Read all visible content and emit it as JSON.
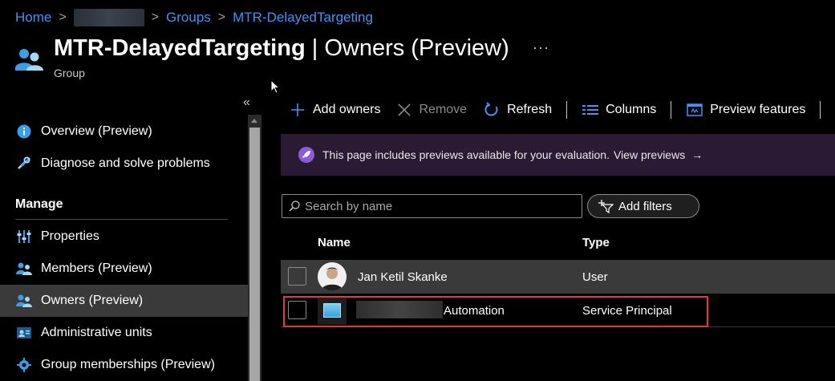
{
  "breadcrumb": {
    "home": "Home",
    "groups": "Groups",
    "current": "MTR-DelayedTargeting",
    "separator": ">"
  },
  "header": {
    "title_strong": "MTR-DelayedTargeting",
    "title_rest": " | Owners (Preview)",
    "subtitle": "Group",
    "more": "···"
  },
  "sidebar": {
    "collapse": "«",
    "manage_heading": "Manage",
    "items": [
      {
        "label": "Overview (Preview)",
        "icon": "info-icon"
      },
      {
        "label": "Diagnose and solve problems",
        "icon": "wrench-icon"
      },
      {
        "label": "Properties",
        "icon": "properties-icon"
      },
      {
        "label": "Members (Preview)",
        "icon": "members-icon"
      },
      {
        "label": "Owners (Preview)",
        "icon": "owners-icon",
        "selected": true
      },
      {
        "label": "Administrative units",
        "icon": "admin-units-icon"
      },
      {
        "label": "Group memberships (Preview)",
        "icon": "gear-icon"
      }
    ]
  },
  "toolbar": {
    "add_owners": "Add owners",
    "remove": "Remove",
    "refresh": "Refresh",
    "columns": "Columns",
    "preview_features": "Preview features"
  },
  "banner": {
    "text": "This page includes previews available for your evaluation.",
    "link": "View previews",
    "arrow": "→"
  },
  "search": {
    "placeholder": "Search by name",
    "value": ""
  },
  "filters": {
    "label": "Add filters"
  },
  "table": {
    "columns": [
      "Name",
      "Type"
    ],
    "rows": [
      {
        "name": "Jan Ketil Skanke",
        "type": "User"
      },
      {
        "name": "Automation",
        "type": "Service Principal"
      }
    ]
  },
  "colors": {
    "link": "#4a90f2",
    "banner_bg": "#2b1a33",
    "highlight": "#e03a3a",
    "selected_bg": "#3a3a3a"
  }
}
